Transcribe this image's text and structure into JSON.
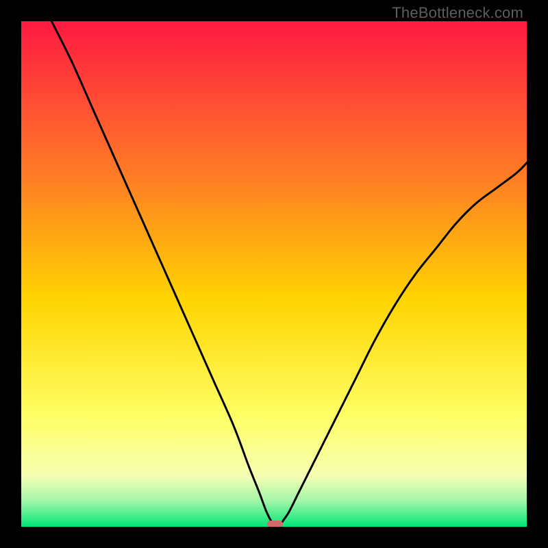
{
  "watermark": {
    "text": "TheBottleneck.com"
  },
  "colors": {
    "frame": "#000000",
    "gradient_top": "#ff1a42",
    "gradient_mid_upper": "#ff7a26",
    "gradient_mid": "#ffd400",
    "gradient_mid_lower": "#ffff64",
    "gradient_low": "#f6ffb3",
    "gradient_green_light": "#9ff5a8",
    "gradient_green": "#00e676",
    "curve": "#000000",
    "marker": "#d46a6a"
  },
  "chart_data": {
    "type": "line",
    "title": "",
    "xlabel": "",
    "ylabel": "",
    "xlim": [
      0,
      100
    ],
    "ylim": [
      0,
      100
    ],
    "x": [
      6,
      10,
      14,
      18,
      22,
      26,
      30,
      34,
      38,
      42,
      45,
      47,
      48.5,
      49.5,
      50,
      50.5,
      51,
      51.5,
      52,
      53,
      55,
      58,
      62,
      66,
      70,
      74,
      78,
      82,
      86,
      90,
      94,
      98,
      100
    ],
    "values": [
      100,
      92,
      83,
      74,
      65,
      56,
      47,
      38,
      29,
      20,
      12,
      7,
      3,
      1,
      0.5,
      0.5,
      0.5,
      0.8,
      1.5,
      3,
      7,
      13,
      21,
      29,
      37,
      44,
      50,
      55,
      60,
      64,
      67,
      70,
      72
    ],
    "annotations": [],
    "marker": {
      "x": 50.2,
      "y": 0.5,
      "width_pct": 3.0,
      "height_pct": 1.4
    }
  }
}
